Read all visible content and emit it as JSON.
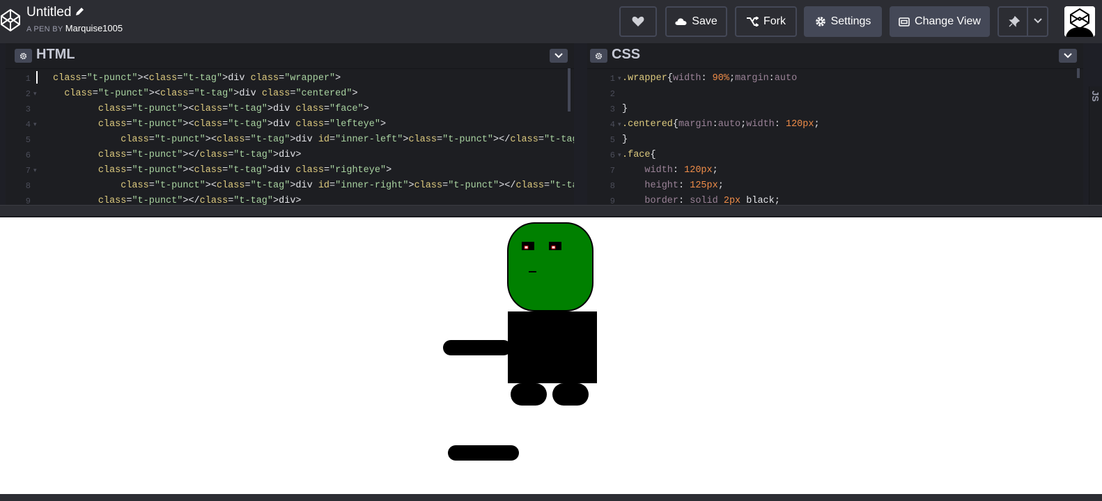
{
  "header": {
    "title": "Untitled",
    "byline_prefix": "A PEN BY",
    "author": "Marquise1005",
    "buttons": {
      "heart_icon": "heart-icon",
      "save": "Save",
      "fork": "Fork",
      "settings": "Settings",
      "change_view": "Change View"
    }
  },
  "html_panel": {
    "title": "HTML",
    "lines": [
      {
        "n": "1",
        "fold": "",
        "code": "<div class=\"wrapper\">"
      },
      {
        "n": "2",
        "fold": "▾",
        "code": "  <div class=\"centered\">"
      },
      {
        "n": "3",
        "fold": "",
        "code": "        <div class=\"face\">"
      },
      {
        "n": "4",
        "fold": "▾",
        "code": "        <div class=\"lefteye\">"
      },
      {
        "n": "5",
        "fold": "",
        "code": "            <div id=\"inner-left\"></div>"
      },
      {
        "n": "6",
        "fold": "",
        "code": "        </div>"
      },
      {
        "n": "7",
        "fold": "▾",
        "code": "        <div class=\"righteye\">"
      },
      {
        "n": "8",
        "fold": "",
        "code": "            <div id=\"inner-right\"></div>"
      },
      {
        "n": "9",
        "fold": "",
        "code": "        </div>"
      }
    ]
  },
  "css_panel": {
    "title": "CSS",
    "lines": [
      {
        "n": "1",
        "fold": "▾",
        "code": ".wrapper{width: 90%;margin:auto"
      },
      {
        "n": "2",
        "fold": "",
        "code": ""
      },
      {
        "n": "3",
        "fold": "",
        "code": "}"
      },
      {
        "n": "4",
        "fold": "▾",
        "code": ".centered{margin:auto;width: 120px;"
      },
      {
        "n": "5",
        "fold": "",
        "code": "}"
      },
      {
        "n": "6",
        "fold": "▾",
        "code": ".face{"
      },
      {
        "n": "7",
        "fold": "",
        "code": "    width: 120px;"
      },
      {
        "n": "8",
        "fold": "",
        "code": "    height: 125px;"
      },
      {
        "n": "9",
        "fold": "",
        "code": "    border: solid 2px black;"
      }
    ]
  },
  "js_panel": {
    "title": "JS"
  },
  "colors": {
    "face": "#008000",
    "accent_bg": "#444857"
  }
}
